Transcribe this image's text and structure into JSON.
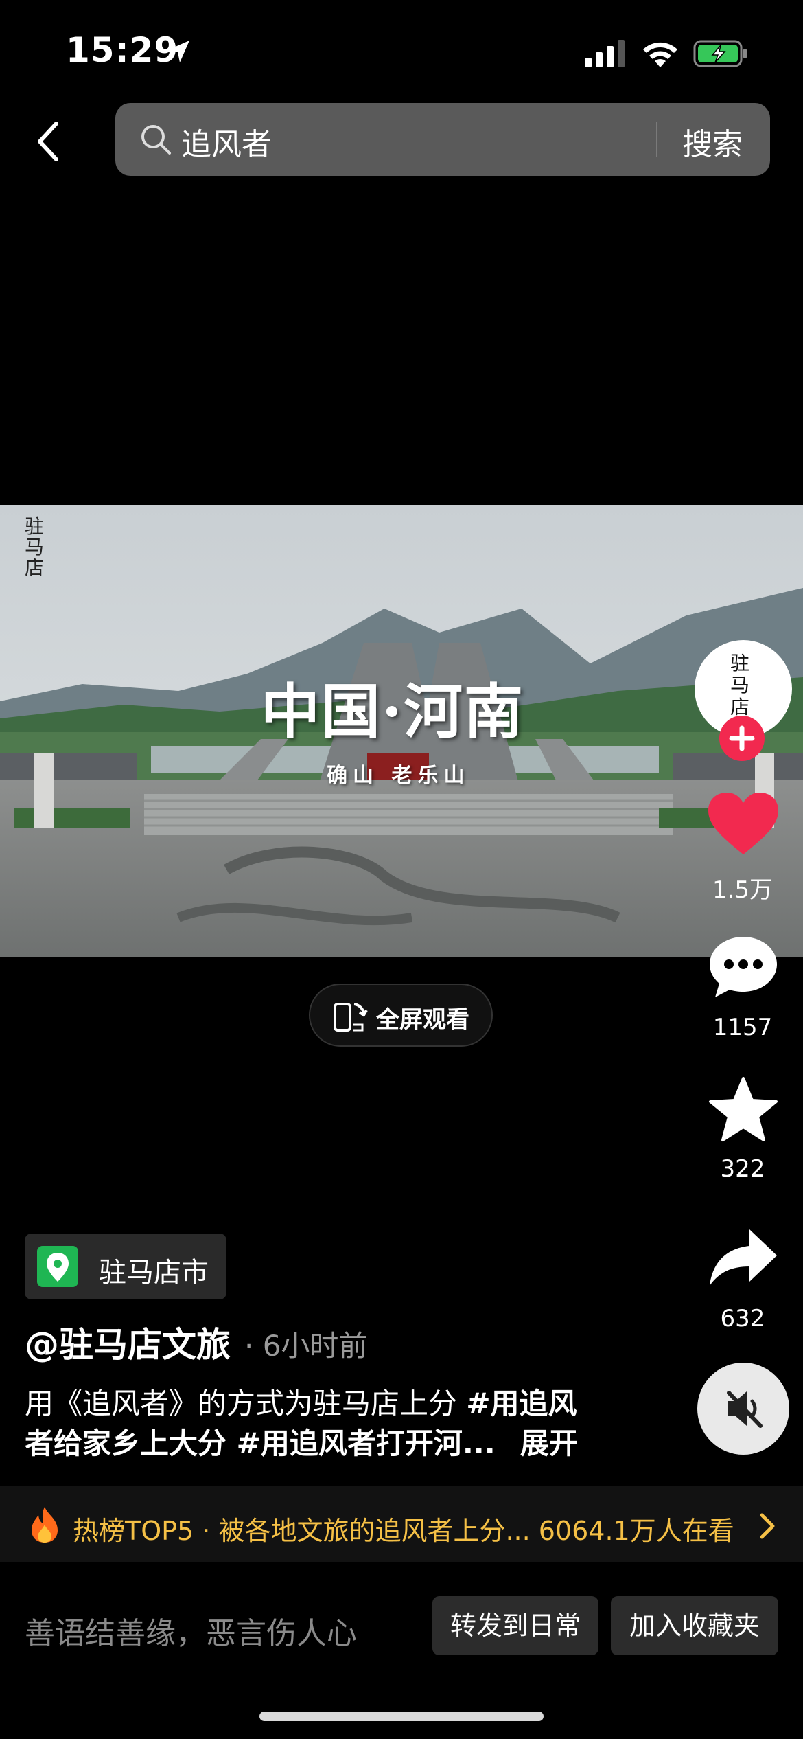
{
  "status_bar": {
    "time": "15:29",
    "icons": [
      "location-arrow-icon",
      "signal-icon",
      "wifi-icon",
      "battery-charging-icon"
    ],
    "battery_color": "#36c759"
  },
  "search": {
    "query": "追风者",
    "button": "搜索"
  },
  "video": {
    "watermark": "驻马店",
    "title": "中国·河南",
    "subtitle": "确山 老乐山",
    "fullscreen_label": "全屏观看"
  },
  "rail": {
    "avatar_text": "驻马店",
    "likes": "1.5万",
    "comments": "1157",
    "favorites": "322",
    "shares": "632",
    "like_color": "#f2294f"
  },
  "post": {
    "location": "驻马店市",
    "author": "@驻马店文旅",
    "time_ago": "· 6小时前",
    "desc_line1_plain": "用《追风者》的方式为驻马店上分 ",
    "desc_line1_tag": "#用追风",
    "desc_line2_tag": "者给家乡上大分 #用追风者打开河...",
    "expand": "展开"
  },
  "hot_banner": {
    "text": "热榜TOP5 · 被各地文旅的追风者上分... 6064.1万人在看",
    "color": "#f5c046"
  },
  "bottom_bar": {
    "comment_placeholder": "善语结善缘，恶言伤人心",
    "share_button": "转发到日常",
    "collect_button": "加入收藏夹"
  }
}
